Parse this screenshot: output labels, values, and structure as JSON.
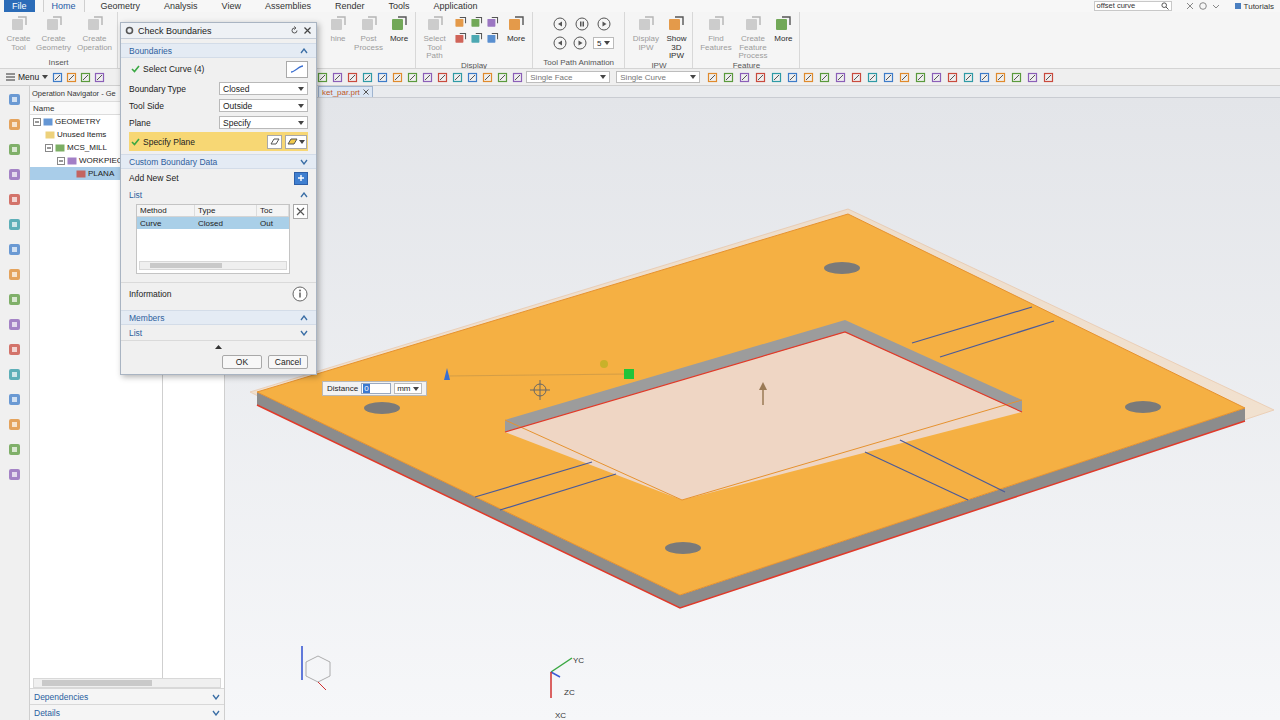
{
  "ribbon": {
    "tabs": [
      {
        "label": "File",
        "selected": false
      },
      {
        "label": "Home",
        "selected": true
      },
      {
        "label": "Geometry",
        "selected": false
      },
      {
        "label": "Analysis",
        "selected": false
      },
      {
        "label": "View",
        "selected": false
      },
      {
        "label": "Assemblies",
        "selected": false
      },
      {
        "label": "Render",
        "selected": false
      },
      {
        "label": "Tools",
        "selected": false
      },
      {
        "label": "Application",
        "selected": false
      }
    ],
    "search": "offset curve",
    "tutorials": "Tutorials",
    "groups_left": [
      {
        "kind": "buttons",
        "label": "Insert",
        "buttons": [
          {
            "label": "Create Tool",
            "disabled": true
          },
          {
            "label": "Create Geometry",
            "disabled": true
          },
          {
            "label": "Create Operation",
            "disabled": true
          }
        ]
      }
    ],
    "groups_right": [
      {
        "kind": "buttons",
        "buttons": [
          {
            "label": "hine",
            "disabled": true
          },
          {
            "label": "Post Process",
            "disabled": true
          },
          {
            "label": "More",
            "disabled": false
          }
        ]
      },
      {
        "kind": "display",
        "label": "Display",
        "buttons": [
          {
            "label": "Select Tool Path",
            "disabled": true
          },
          {
            "label": "More",
            "disabled": false
          }
        ]
      },
      {
        "kind": "animation",
        "label": "Tool Path Animation",
        "speed": "5"
      },
      {
        "kind": "buttons",
        "label": "IPW",
        "buttons": [
          {
            "label": "Display IPW",
            "disabled": true
          },
          {
            "label": "Show 3D IPW",
            "disabled": false
          }
        ]
      },
      {
        "kind": "buttons",
        "label": "Feature",
        "buttons": [
          {
            "label": "Find Features",
            "disabled": true
          },
          {
            "label": "Create Feature Process",
            "disabled": true
          },
          {
            "label": "More",
            "disabled": false
          }
        ]
      }
    ]
  },
  "toolbar": {
    "menu": "Menu",
    "filters": [
      "Single Face",
      "Single Curve"
    ]
  },
  "navigator": {
    "title": "Operation Navigator - Ge",
    "column": "Name",
    "items": [
      {
        "label": "GEOMETRY",
        "depth": 0,
        "selected": false,
        "expanded": true
      },
      {
        "label": "Unused Items",
        "depth": 1,
        "selected": false
      },
      {
        "label": "MCS_MILL",
        "depth": 1,
        "selected": false,
        "expanded": true
      },
      {
        "label": "WORKPIECE",
        "depth": 2,
        "selected": false,
        "expanded": true
      },
      {
        "label": "PLANA",
        "depth": 3,
        "selected": true
      }
    ],
    "footer": [
      "Dependencies",
      "Details"
    ]
  },
  "canvas": {
    "file_tab": "ket_par.prt",
    "distance": {
      "label": "Distance",
      "value": "0",
      "unit": "mm"
    },
    "axes": [
      {
        "label": "YC",
        "color": "#3aa843"
      },
      {
        "label": "ZC",
        "color": "#3b5bd6"
      },
      {
        "label": "XC",
        "color": "#d03030"
      }
    ]
  },
  "dialog": {
    "title": "Check Boundaries",
    "boundaries_header": "Boundaries",
    "select_curve": "Select Curve (4)",
    "fields": [
      {
        "label": "Boundary Type",
        "value": "Closed"
      },
      {
        "label": "Tool Side",
        "value": "Outside"
      },
      {
        "label": "Plane",
        "value": "Specify"
      }
    ],
    "specify_plane": {
      "label": "Specify Plane",
      "highlighted": true
    },
    "custom_boundary": "Custom Boundary Data",
    "add_new_set": "Add New Set",
    "list_header": "List",
    "list_columns": [
      "Method",
      "Type",
      "Toc"
    ],
    "list_rows": [
      {
        "cells": [
          "Curve",
          "Closed",
          "Out"
        ],
        "selected": true
      }
    ],
    "information": "Information",
    "members_header": "Members",
    "members_list": "List",
    "buttons": [
      "OK",
      "Cancel"
    ]
  }
}
